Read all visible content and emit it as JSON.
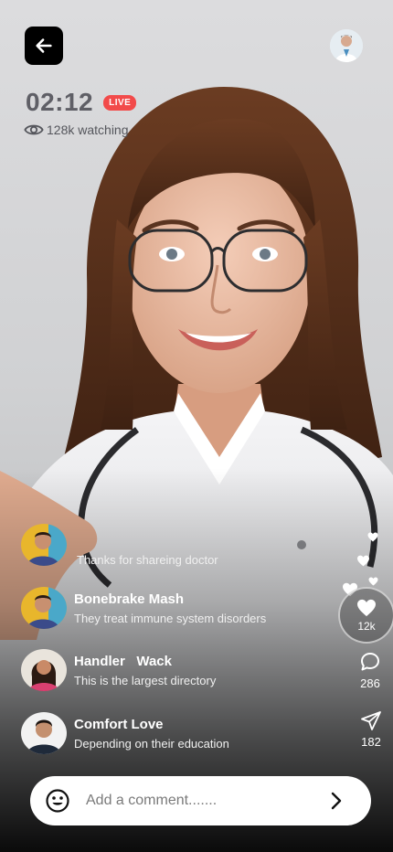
{
  "stream": {
    "timer": "02:12",
    "live_label": "LIVE",
    "watching": "128k watching"
  },
  "comments": [
    {
      "name": "",
      "message": "Thanks for shareing doctor",
      "avatar": "avatar-man-yellow"
    },
    {
      "name": "Bonebrake Mash",
      "message": "They treat immune system disorders",
      "avatar": "avatar-man-yellow"
    },
    {
      "name": "Handler   Wack",
      "message": "This is the largest directory",
      "avatar": "avatar-woman"
    },
    {
      "name": "Comfort Love",
      "message": "Depending on their education",
      "avatar": "avatar-man-dark"
    }
  ],
  "actions": {
    "likes": "12k",
    "comments": "286",
    "shares": "182"
  },
  "comment_input": {
    "placeholder": "Add a comment......."
  },
  "icons": {
    "back": "arrow-left-icon",
    "eye": "eye-icon",
    "heart": "heart-icon",
    "comment": "comment-bubble-icon",
    "share": "paper-plane-icon",
    "emoji": "smiley-icon",
    "send": "chevron-right-icon"
  },
  "colors": {
    "live_badge": "#f24a4a",
    "input_bg": "#ffffff",
    "back_button": "#000000"
  }
}
